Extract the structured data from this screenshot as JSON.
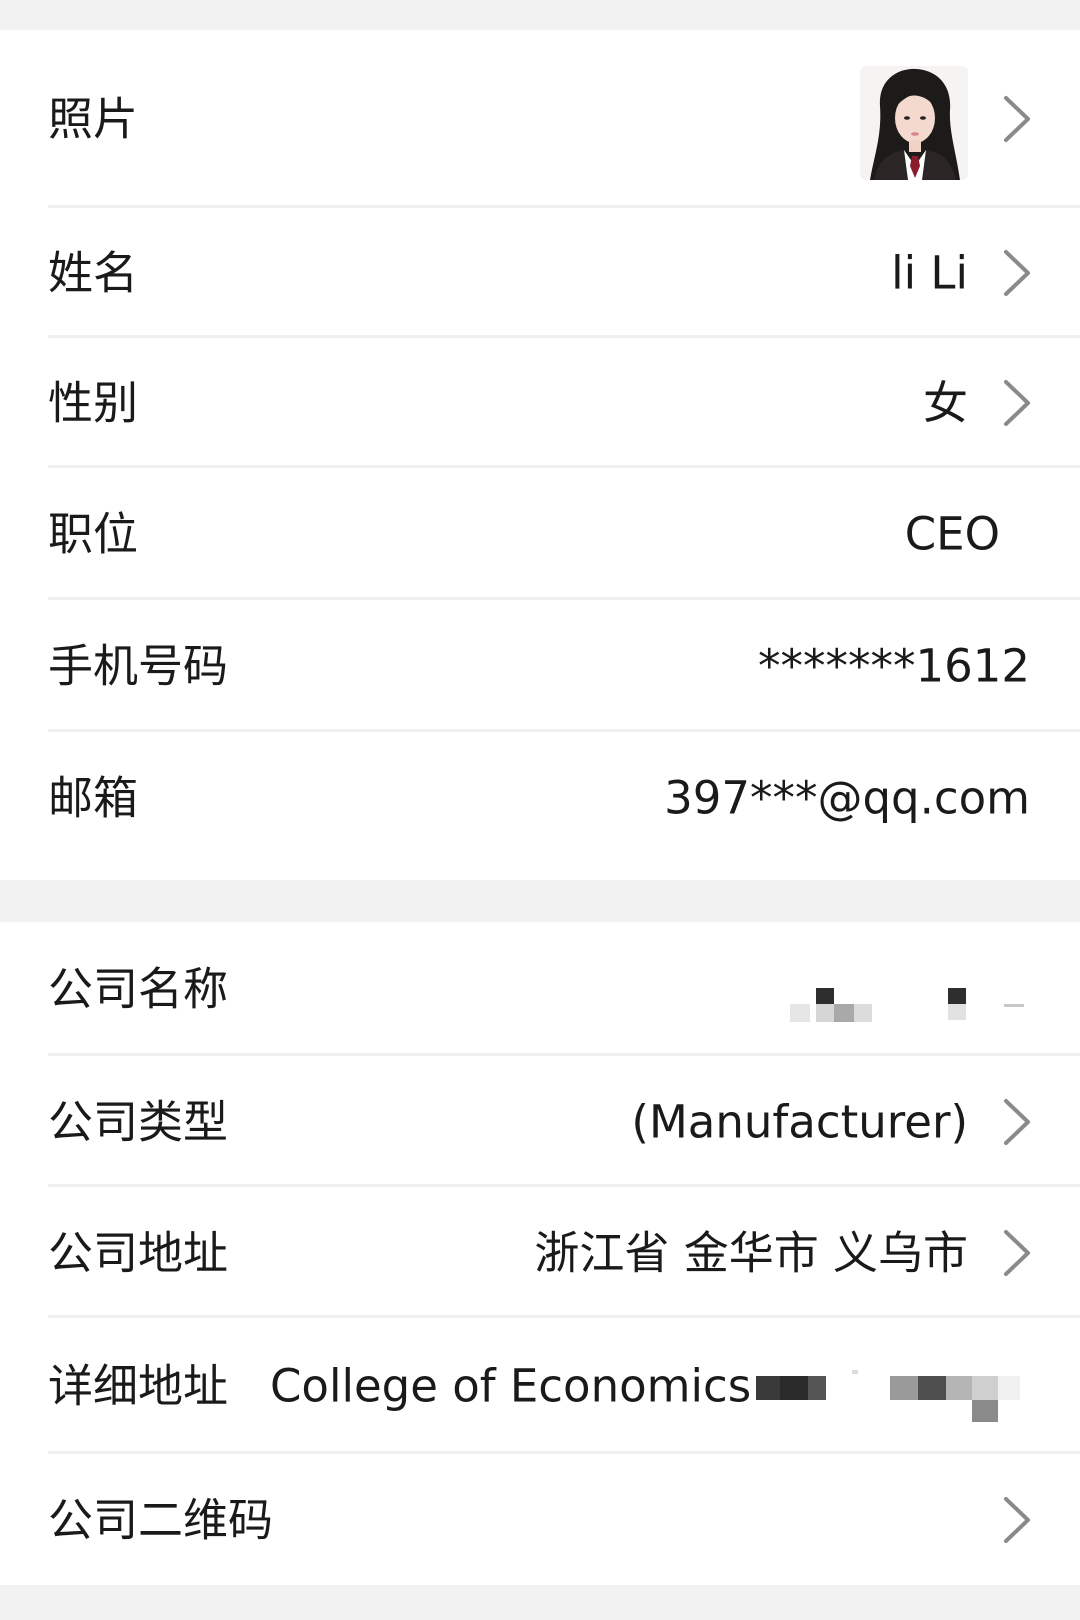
{
  "personal": {
    "photo": {
      "label": "照片",
      "avatar_icon": "avatar-photo"
    },
    "name": {
      "label": "姓名",
      "value": "li Li"
    },
    "gender": {
      "label": "性别",
      "value": "女"
    },
    "position": {
      "label": "职位",
      "value": "CEO"
    },
    "phone": {
      "label": "手机号码",
      "value": "*******1612"
    },
    "email": {
      "label": "邮箱",
      "value": "397***@qq.com"
    }
  },
  "company": {
    "name": {
      "label": "公司名称",
      "value_obscured": true
    },
    "type": {
      "label": "公司类型",
      "value": "(Manufacturer)"
    },
    "address": {
      "label": "公司地址",
      "value": "浙江省 金华市 义乌市"
    },
    "detail_address": {
      "label": "详细地址",
      "value": "College of Economics",
      "value_suffix_obscured": true
    },
    "qrcode": {
      "label": "公司二维码"
    }
  },
  "icons": {
    "chevron": "chevron-right-icon"
  },
  "colors": {
    "background": "#f2f2f2",
    "row_background": "#ffffff",
    "divider": "#efefef",
    "text": "#1a1a1a",
    "chevron": "#8a8a8a"
  }
}
